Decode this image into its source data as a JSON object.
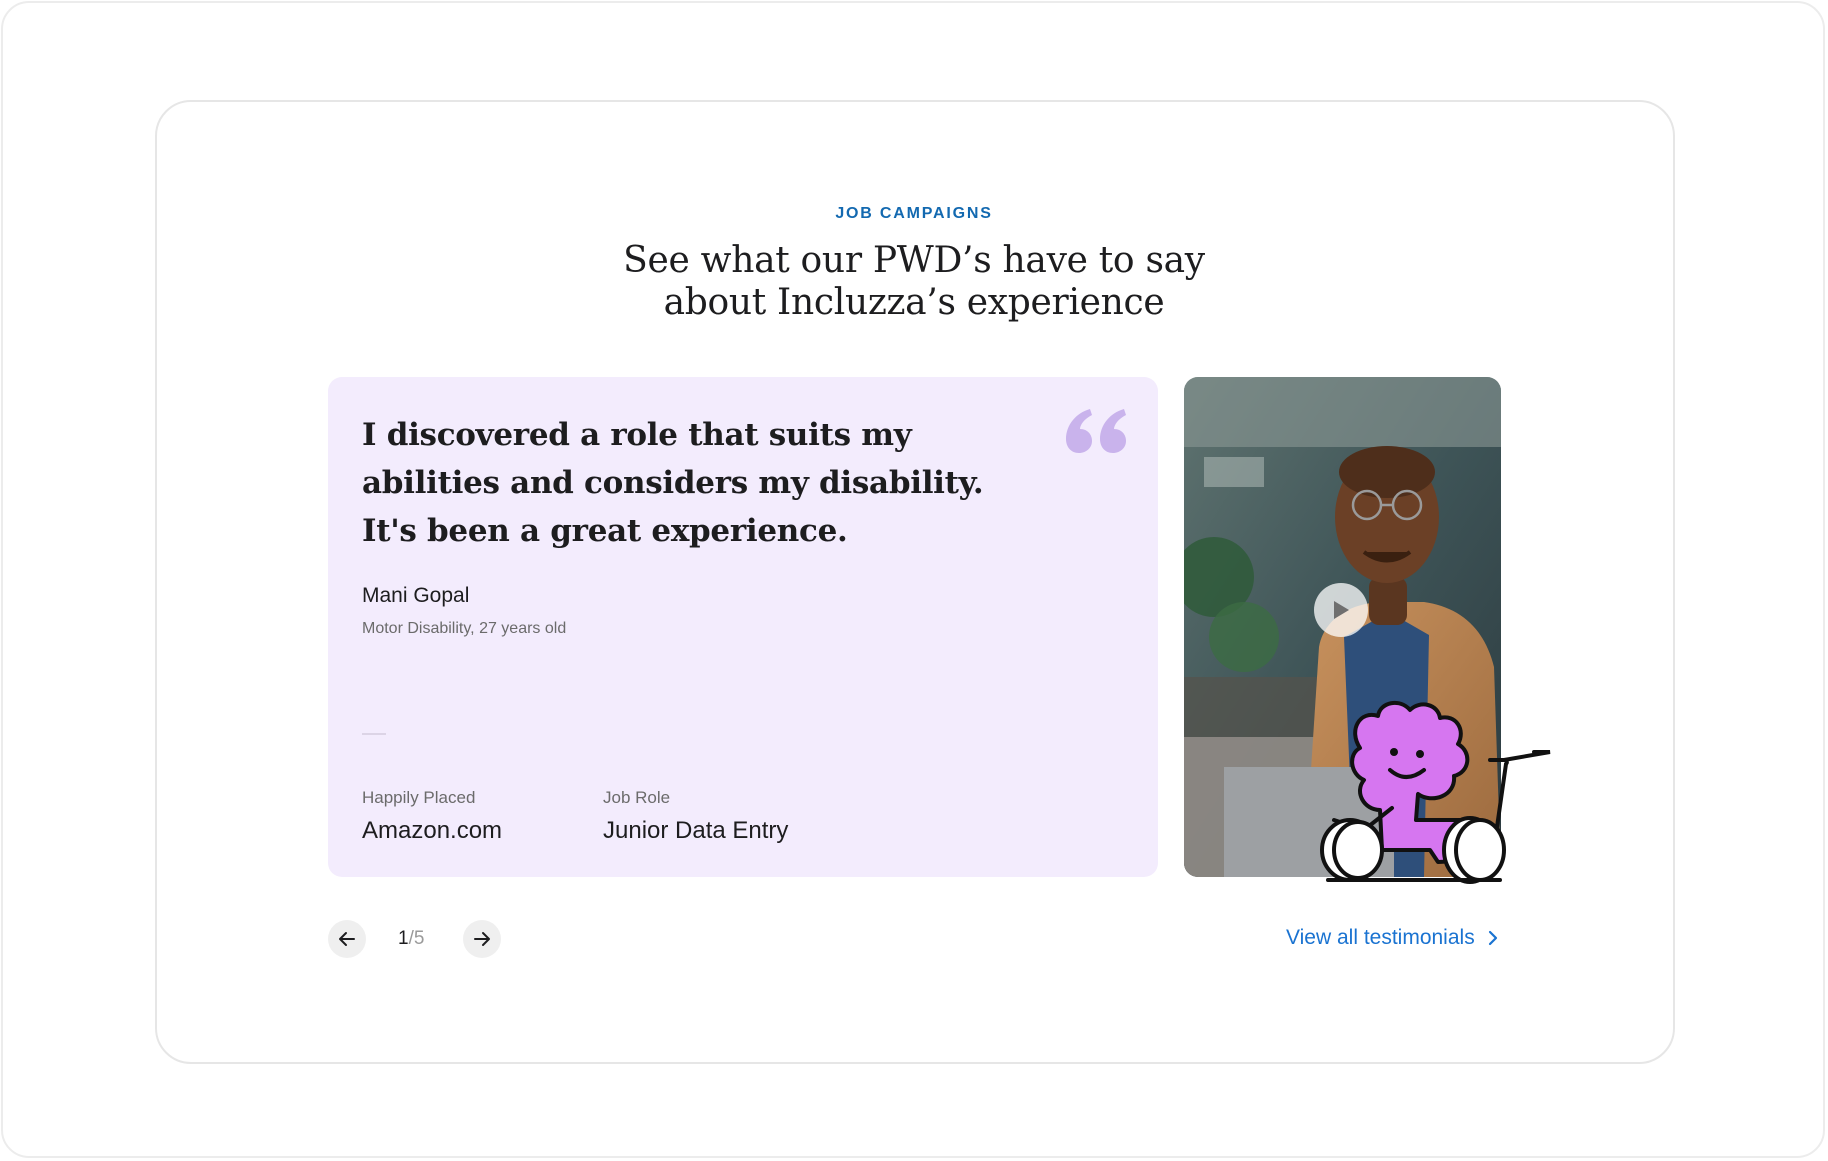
{
  "section": {
    "eyebrow": "JOB CAMPAIGNS",
    "heading_line1": "See what our PWD’s have to say",
    "heading_line2": "about Incluzza’s experience"
  },
  "testimonial": {
    "quote_lines": [
      "I discovered a role that suits my",
      "abilities and considers my disability.",
      "It's been a great experience."
    ],
    "name": "Mani Gopal",
    "meta": "Motor Disability, 27 years old",
    "placed_label": "Happily Placed",
    "placed_value": "Amazon.com",
    "role_label": "Job Role",
    "role_value": "Junior Data Entry",
    "quote_icon": "quote-mark-icon",
    "video_icon": "play-icon"
  },
  "pager": {
    "current": "1",
    "separator": "/",
    "total": "5",
    "prev_icon": "arrow-left-icon",
    "next_icon": "arrow-right-icon"
  },
  "view_all": {
    "label": "View all testimonials",
    "icon": "chevron-right-icon"
  },
  "colors": {
    "accent": "#1369b0",
    "link": "#1a73d1",
    "card_bg": "#f3ecfd",
    "quote_mark": "#c9b3ec",
    "mascot": "#d676f0"
  }
}
